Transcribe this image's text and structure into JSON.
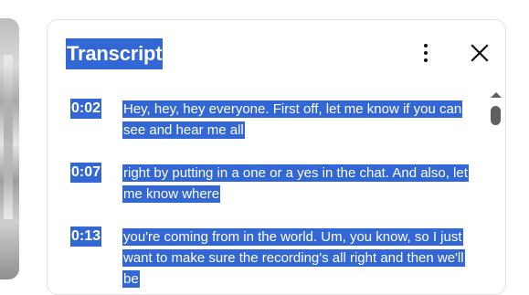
{
  "panel": {
    "title": "Transcript",
    "more_icon": "more-vert-icon",
    "close_icon": "close-icon"
  },
  "segments": [
    {
      "time": "0:02",
      "text": "Hey, hey, hey everyone. First off, let me know if you can see and hear me all"
    },
    {
      "time": "0:07",
      "text": "right by putting in a one or a yes in the chat. And also, let me know where"
    },
    {
      "time": "0:13",
      "text": "you're coming from in the world. Um, you know, so I just want to make sure the recording's all right and then we'll be"
    }
  ],
  "colors": {
    "selection": "#3367d6",
    "icon": "#0f0f0f",
    "scrollbar": "#606060"
  }
}
